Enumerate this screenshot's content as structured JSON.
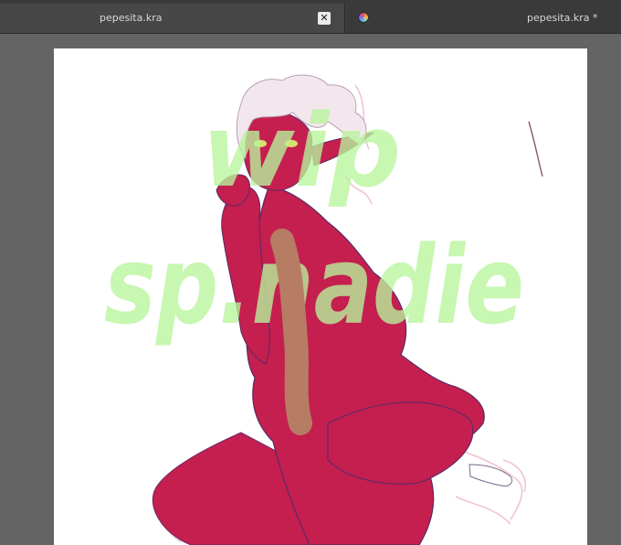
{
  "tabs": [
    {
      "label": "pepesita.kra",
      "active": true,
      "close_icon": "close-icon"
    },
    {
      "label": "pepesita.kra *",
      "active": false,
      "icon": "krita-app-icon"
    }
  ],
  "watermark": {
    "line1": "wip",
    "line2": "sp.nadie"
  },
  "colors": {
    "background": "#646464",
    "tab_active": "#474747",
    "tab_inactive": "#3a3a3a",
    "figure_skin": "#c41f4f",
    "watermark_green": "#b8f59c",
    "watermark_tan": "#b3986a",
    "hair": "#f3e7ee",
    "eyes": "#d9e070"
  }
}
